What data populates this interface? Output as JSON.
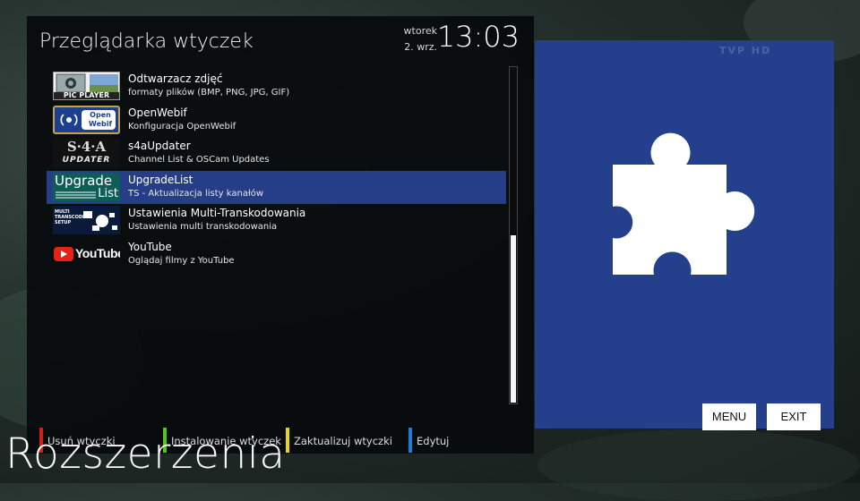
{
  "panel": {
    "title": "Przeglądarka wtyczek",
    "date_day": "wtorek",
    "date_dm": "2. wrz.",
    "clock": "13:03"
  },
  "plugins": [
    {
      "name": "Odtwarzacz zdjęć",
      "desc": "formaty plików (BMP, PNG, JPG, GIF)",
      "icon": "pic-player-icon",
      "icon_text": "PIC PLAYER"
    },
    {
      "name": "OpenWebif",
      "desc": "Konfiguracja OpenWebif",
      "icon": "openwebif-icon",
      "icon_text": "Open Webif"
    },
    {
      "name": "s4aUpdater",
      "desc": "Channel List & OSCam Updates",
      "icon": "s4a-updater-icon",
      "icon_text_top": "S·4·A",
      "icon_text_bottom": "UPDATER"
    },
    {
      "name": "UpgradeList",
      "desc": "TS - Aktualizacja listy kanałów",
      "icon": "upgrade-list-icon",
      "icon_text_top": "Upgrade",
      "icon_text_bottom": "List"
    },
    {
      "name": "Ustawienia Multi-Transkodowania",
      "desc": "Ustawienia multi transkodowania",
      "icon": "multi-transcoding-icon",
      "icon_text": "MULTI TRANSCODING SETUP"
    },
    {
      "name": "YouTube",
      "desc": "Oglądaj filmy z YouTube",
      "icon": "youtube-icon",
      "icon_text": "YouTube"
    }
  ],
  "selected_index": 3,
  "keys": {
    "red": "Usuń wtyczki",
    "green": "Instalowanie wtyczek",
    "yellow": "Zaktualizuj wtyczki",
    "blue": "Edytuj"
  },
  "key_colors": {
    "red": "#d0201c",
    "green": "#52c41a",
    "yellow": "#e8d21c",
    "blue": "#1e7bd6"
  },
  "brand": "Rozszerzenia",
  "preview": {
    "watermark": "TVP HD",
    "menu_button": "MENU",
    "exit_button": "EXIT",
    "icon": "puzzle-piece-icon"
  },
  "colors": {
    "selection": "#263e87",
    "preview_bg": "#24408d"
  }
}
